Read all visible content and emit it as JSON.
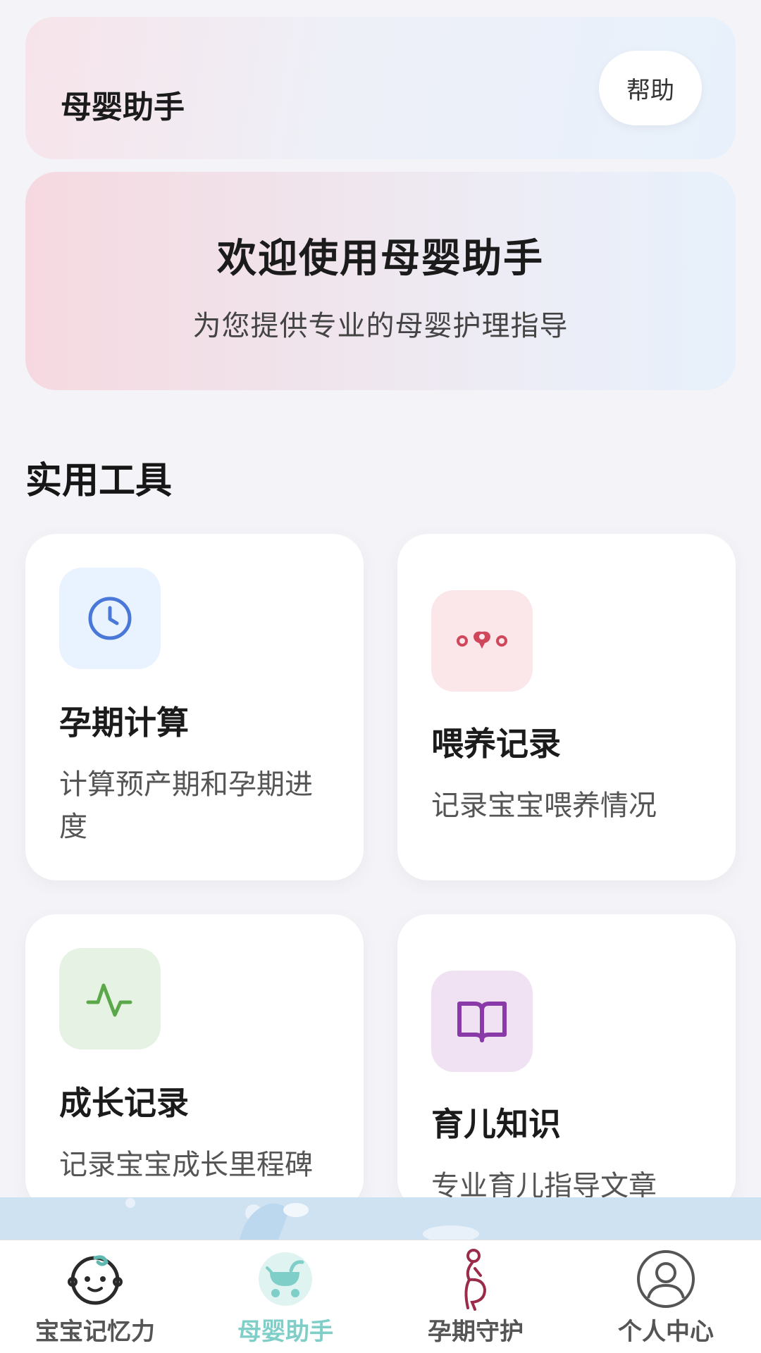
{
  "header": {
    "title": "母婴助手",
    "help_label": "帮助"
  },
  "banner": {
    "title": "欢迎使用母婴助手",
    "subtitle": "为您提供专业的母婴护理指导"
  },
  "tools": {
    "section_title": "实用工具",
    "cards": [
      {
        "title": "孕期计算",
        "desc": "计算预产期和孕期进度",
        "icon": "clock-icon",
        "color": "#4a78d8",
        "bg": "#e9f3ff"
      },
      {
        "title": "喂养记录",
        "desc": "记录宝宝喂养情况",
        "icon": "feeding-icon",
        "color": "#d0465a",
        "bg": "#fbe6ea"
      },
      {
        "title": "成长记录",
        "desc": "记录宝宝成长里程碑",
        "icon": "activity-icon",
        "color": "#5aa84a",
        "bg": "#e6f3e4"
      },
      {
        "title": "育儿知识",
        "desc": "专业育儿指导文章",
        "icon": "book-icon",
        "color": "#8a3aa8",
        "bg": "#f0e2f3"
      }
    ]
  },
  "tabbar": {
    "tabs": [
      {
        "label": "宝宝记忆力",
        "icon": "baby-face-icon"
      },
      {
        "label": "母婴助手",
        "icon": "stroller-icon",
        "active": true
      },
      {
        "label": "孕期守护",
        "icon": "pregnant-icon"
      },
      {
        "label": "个人中心",
        "icon": "user-icon"
      }
    ],
    "active_color": "#7fcfc8"
  }
}
